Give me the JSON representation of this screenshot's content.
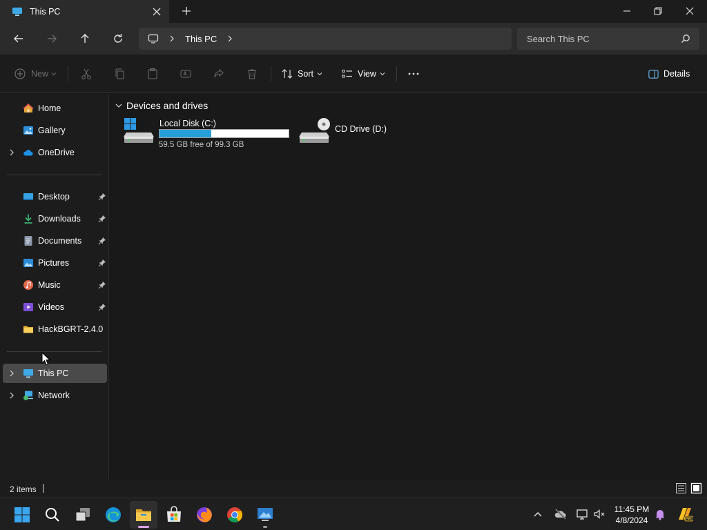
{
  "window": {
    "tab_title": "This PC",
    "new_tab_label": "+"
  },
  "address": {
    "crumbs": [
      "This PC"
    ],
    "search_placeholder": "Search This PC"
  },
  "commands": {
    "new_label": "New",
    "sort_label": "Sort",
    "view_label": "View",
    "details_label": "Details"
  },
  "sidebar": {
    "items": [
      {
        "label": "Home",
        "icon": "home-icon"
      },
      {
        "label": "Gallery",
        "icon": "gallery-icon"
      },
      {
        "label": "OneDrive",
        "icon": "cloud-icon"
      },
      {
        "label": "Desktop",
        "icon": "desktop-icon"
      },
      {
        "label": "Downloads",
        "icon": "download-icon"
      },
      {
        "label": "Documents",
        "icon": "document-icon"
      },
      {
        "label": "Pictures",
        "icon": "picture-icon"
      },
      {
        "label": "Music",
        "icon": "music-icon"
      },
      {
        "label": "Videos",
        "icon": "video-icon"
      },
      {
        "label": "HackBGRT-2.4.0",
        "icon": "folder-icon"
      },
      {
        "label": "This PC",
        "icon": "pc-icon"
      },
      {
        "label": "Network",
        "icon": "network-icon"
      }
    ]
  },
  "main": {
    "group_title": "Devices and drives",
    "drives": [
      {
        "name": "Local Disk (C:)",
        "free_text": "59.5 GB free of 99.3 GB",
        "used_fraction": 0.4
      },
      {
        "name": "CD Drive (D:)"
      }
    ]
  },
  "status": {
    "item_count": "2 items"
  },
  "taskbar": {
    "time": "11:45 PM",
    "date": "4/8/2024"
  },
  "colors": {
    "accent": "#26a0da",
    "selection": "#4a4a4a"
  }
}
